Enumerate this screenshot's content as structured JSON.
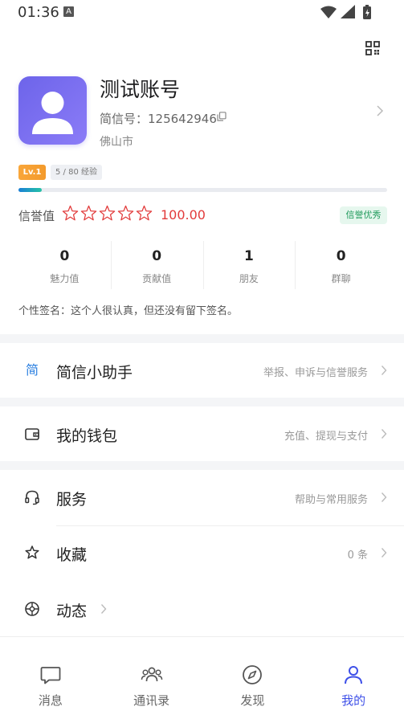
{
  "status_bar": {
    "time": "01:36",
    "notification_glyph": "A"
  },
  "profile": {
    "name": "测试账号",
    "id_text": "简信号：125642946",
    "city": "佛山市",
    "level": "Lv.1",
    "exp": "5 / 80 经验",
    "exp_progress": 0.0625,
    "credit_label": "信誉值",
    "credit_stars_filled": 0,
    "credit_stars_total": 5,
    "credit_score": "100.00",
    "credit_tag": "信誉优秀",
    "signature": "个性签名：这个人很认真，但还没有留下签名。"
  },
  "stats": [
    {
      "value": "0",
      "label": "魅力值"
    },
    {
      "value": "0",
      "label": "贡献值"
    },
    {
      "value": "1",
      "label": "朋友"
    },
    {
      "value": "0",
      "label": "群聊"
    }
  ],
  "menu": {
    "assistant": {
      "icon_text": "简",
      "label": "简信小助手",
      "desc": "举报、申诉与信誉服务"
    },
    "wallet": {
      "label": "我的钱包",
      "desc": "充值、提现与支付"
    },
    "service": {
      "label": "服务",
      "desc": "帮助与常用服务"
    },
    "favorites": {
      "label": "收藏",
      "desc": "0 条"
    },
    "moments": {
      "label": "动态",
      "desc": ""
    }
  },
  "tabbar": {
    "tabs": [
      {
        "label": "消息",
        "icon": "chat-bubble-icon"
      },
      {
        "label": "通讯录",
        "icon": "contacts-icon"
      },
      {
        "label": "发现",
        "icon": "compass-icon"
      },
      {
        "label": "我的",
        "icon": "person-icon"
      }
    ],
    "active_index": 3
  },
  "colors": {
    "accent": "#3f51e8",
    "avatar_gradient_start": "#6d64ea",
    "avatar_gradient_end": "#8b7cf7",
    "credit_red": "#e23b3b",
    "credit_tag_green": "#1f9a5b",
    "level_orange": "#f39a2c"
  }
}
